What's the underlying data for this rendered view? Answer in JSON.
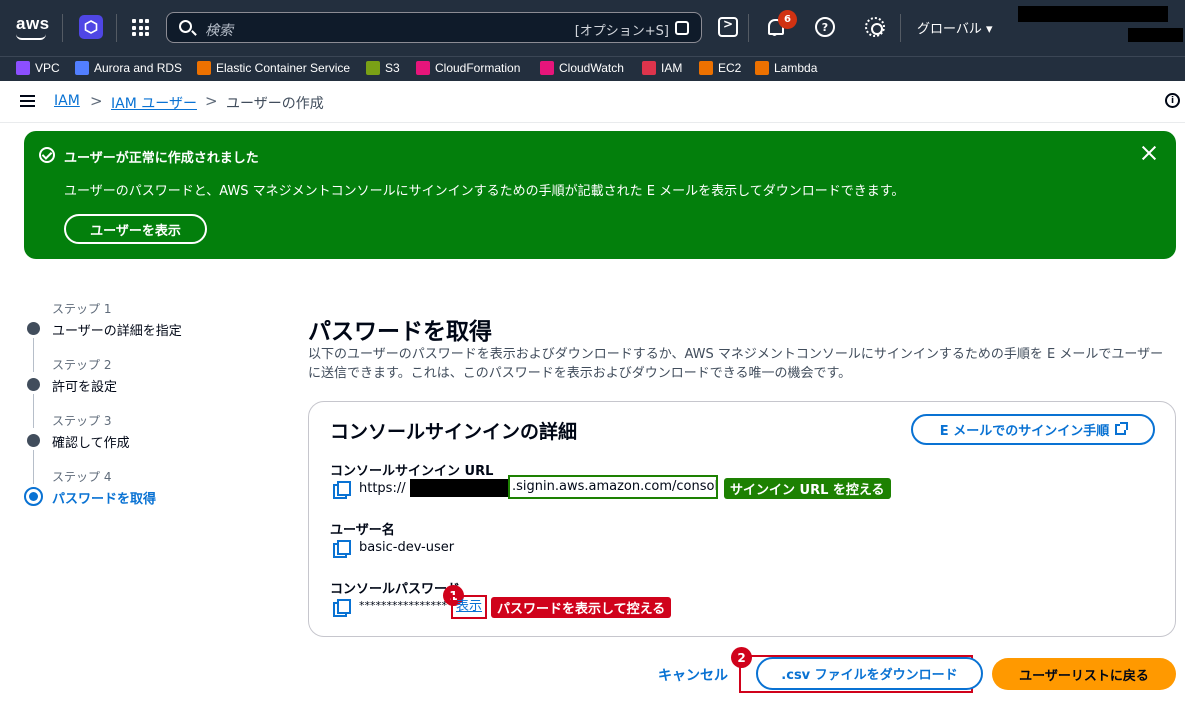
{
  "topnav": {
    "logo": "aws",
    "search_placeholder": "検索",
    "search_hint": "[オプション+S]",
    "notification_count": "6",
    "help_symbol": "?",
    "region": "グローバル ▾"
  },
  "services": [
    {
      "label": "VPC",
      "color": "#8c4fff"
    },
    {
      "label": "Aurora and RDS",
      "color": "#527fff"
    },
    {
      "label": "Elastic Container Service",
      "color": "#ed7100"
    },
    {
      "label": "S3",
      "color": "#7aa116"
    },
    {
      "label": "CloudFormation",
      "color": "#e7157b"
    },
    {
      "label": "CloudWatch",
      "color": "#e7157b"
    },
    {
      "label": "IAM",
      "color": "#dd344c"
    },
    {
      "label": "EC2",
      "color": "#ed7100"
    },
    {
      "label": "Lambda",
      "color": "#ed7100"
    }
  ],
  "breadcrumb": {
    "item1": "IAM",
    "item2": "IAM ユーザー",
    "item3": "ユーザーの作成",
    "sep": ">"
  },
  "flash": {
    "title": "ユーザーが正常に作成されました",
    "body": "ユーザーのパスワードと、AWS マネジメントコンソールにサインインするための手順が記載された E メールを表示してダウンロードできます。",
    "button": "ユーザーを表示"
  },
  "steps": [
    {
      "num": "ステップ 1",
      "label": "ユーザーの詳細を指定"
    },
    {
      "num": "ステップ 2",
      "label": "許可を設定"
    },
    {
      "num": "ステップ 3",
      "label": "確認して作成"
    },
    {
      "num": "ステップ 4",
      "label": "パスワードを取得"
    }
  ],
  "main": {
    "title": "パスワードを取得",
    "description": "以下のユーザーのパスワードを表示およびダウンロードするか、AWS マネジメントコンソールにサインインするための手順を E メールでユーザーに送信できます。これは、このパスワードを表示およびダウンロードできる唯一の機会です。"
  },
  "card": {
    "title": "コンソールサインインの詳細",
    "email_button": "E メールでのサインイン手順",
    "url_label": "コンソールサインイン URL",
    "url_prefix": "https://",
    "url_suffix": ".signin.aws.amazon.com/console",
    "url_tag": "サインイン URL を控える",
    "username_label": "ユーザー名",
    "username": "basic-dev-user",
    "password_label": "コンソールパスワード",
    "password_mask": "****************",
    "show_link": "表示",
    "password_tag": "パスワードを表示して控える",
    "badge1": "1"
  },
  "actions": {
    "cancel": "キャンセル",
    "download": ".csv ファイルをダウンロード",
    "back": "ユーザーリストに戻る",
    "badge2": "2"
  }
}
